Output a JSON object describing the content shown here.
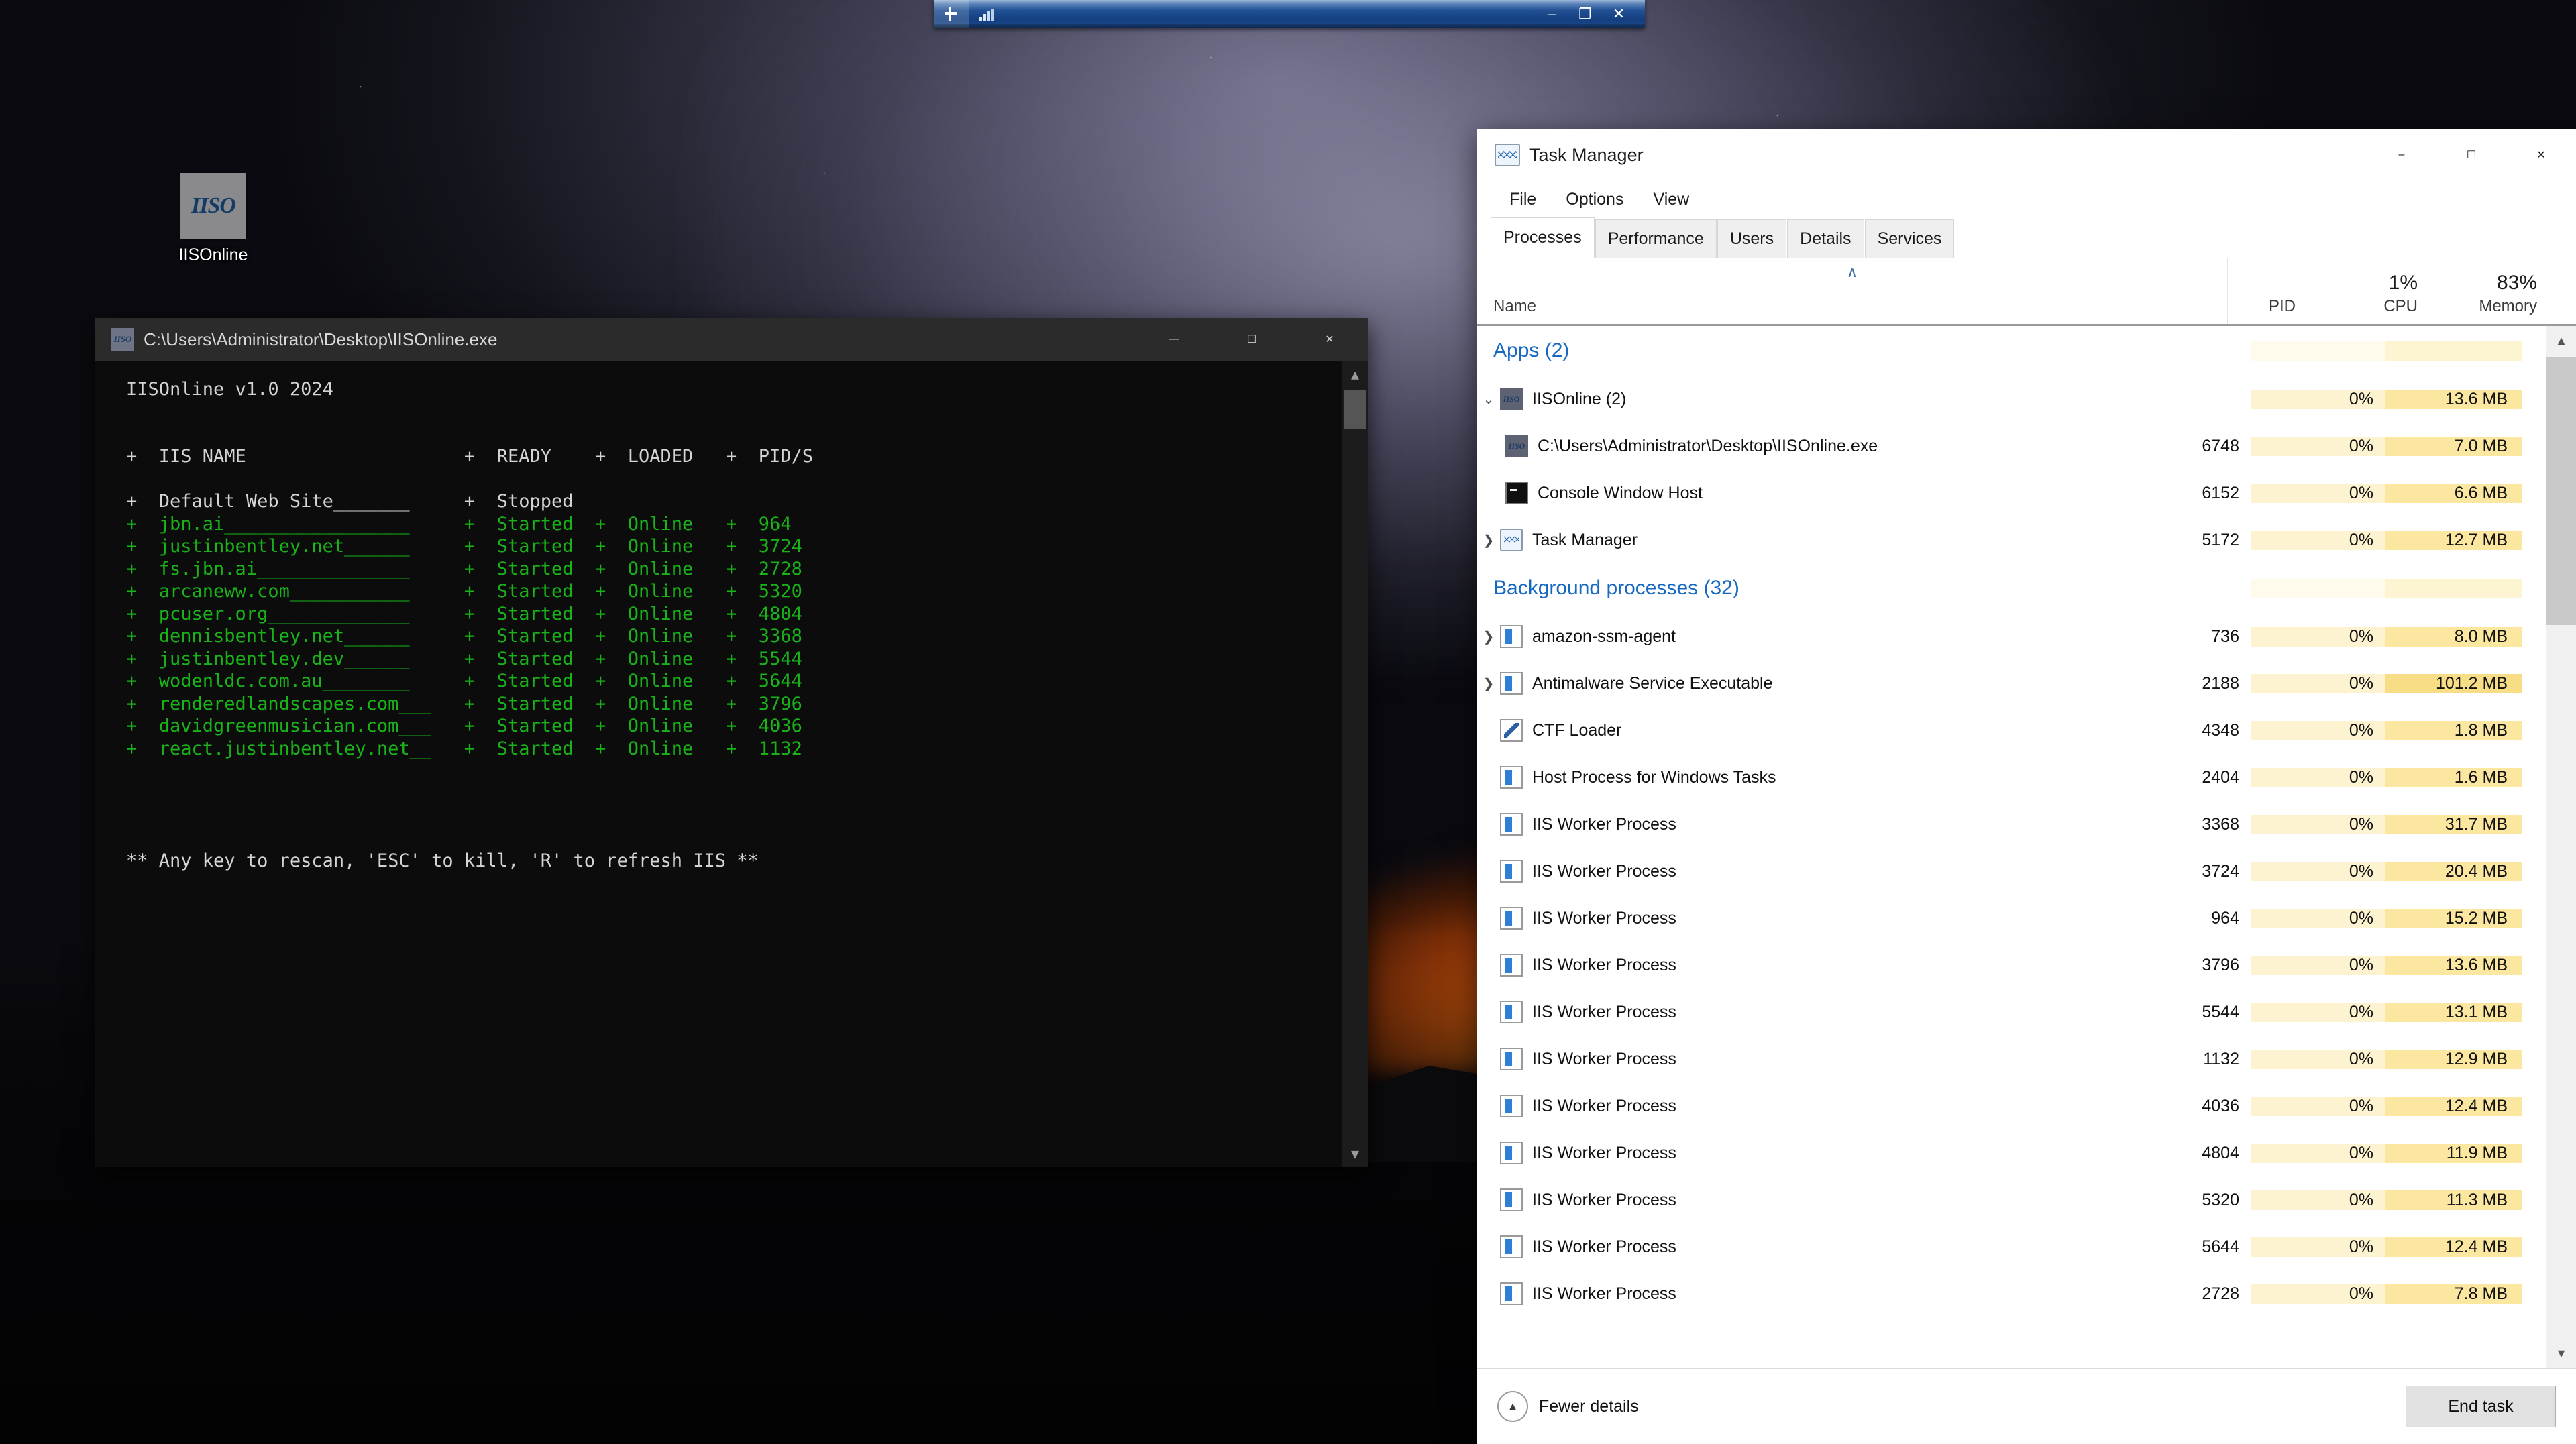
{
  "desktop": {
    "icon": {
      "label": "IISOnline",
      "glyph": "IISO",
      "name": "iisonline-desktop-icon"
    }
  },
  "top_bar": {
    "icons": [
      "pin-icon",
      "signal-bars-icon"
    ],
    "controls": {
      "minimize": "–",
      "restore": "❐",
      "close": "✕"
    }
  },
  "console": {
    "title": "C:\\Users\\Administrator\\Desktop\\IISOnline.exe",
    "icon_glyph": "IISO",
    "controls": {
      "minimize": "—",
      "maximize": "☐",
      "close": "✕"
    },
    "header_line": "IISOnline v1.0 2024",
    "columns": [
      "IIS NAME",
      "READY",
      "LOADED",
      "PID/S"
    ],
    "column_header_text": "+  IIS NAME                       +  READY    +  LOADED   +  PID/S",
    "rows": [
      {
        "name": "Default Web Site",
        "pad": "_______",
        "ready": "Stopped",
        "loaded": "",
        "pid": "",
        "color": "white"
      },
      {
        "name": "jbn.ai",
        "pad": "_________________",
        "ready": "Started",
        "loaded": "Online",
        "pid": "964",
        "color": "green"
      },
      {
        "name": "justinbentley.net",
        "pad": "______",
        "ready": "Started",
        "loaded": "Online",
        "pid": "3724",
        "color": "green"
      },
      {
        "name": "fs.jbn.ai",
        "pad": "______________",
        "ready": "Started",
        "loaded": "Online",
        "pid": "2728",
        "color": "green"
      },
      {
        "name": "arcaneww.com",
        "pad": "___________",
        "ready": "Started",
        "loaded": "Online",
        "pid": "5320",
        "color": "green"
      },
      {
        "name": "pcuser.org",
        "pad": "_____________",
        "ready": "Started",
        "loaded": "Online",
        "pid": "4804",
        "color": "green"
      },
      {
        "name": "dennisbentley.net",
        "pad": "______",
        "ready": "Started",
        "loaded": "Online",
        "pid": "3368",
        "color": "green"
      },
      {
        "name": "justinbentley.dev",
        "pad": "______",
        "ready": "Started",
        "loaded": "Online",
        "pid": "5544",
        "color": "green"
      },
      {
        "name": "wodenldc.com.au",
        "pad": "________",
        "ready": "Started",
        "loaded": "Online",
        "pid": "5644",
        "color": "green"
      },
      {
        "name": "renderedlandscapes.com",
        "pad": "___",
        "ready": "Started",
        "loaded": "Online",
        "pid": "3796",
        "color": "green"
      },
      {
        "name": "davidgreenmusician.com",
        "pad": "___",
        "ready": "Started",
        "loaded": "Online",
        "pid": "4036",
        "color": "green"
      },
      {
        "name": "react.justinbentley.net",
        "pad": "__",
        "ready": "Started",
        "loaded": "Online",
        "pid": "1132",
        "color": "green"
      }
    ],
    "footer": "** Any key to rescan, 'ESC' to kill, 'R' to refresh IIS **"
  },
  "task_manager": {
    "title": "Task Manager",
    "window_controls": {
      "minimize": "–",
      "maximize": "☐",
      "close": "✕"
    },
    "menus": [
      "File",
      "Options",
      "View"
    ],
    "tabs": [
      {
        "label": "Processes",
        "active": true
      },
      {
        "label": "Performance",
        "active": false
      },
      {
        "label": "Users",
        "active": false
      },
      {
        "label": "Details",
        "active": false
      },
      {
        "label": "Services",
        "active": false
      }
    ],
    "columns": {
      "name": "Name",
      "pid": "PID",
      "cpu": "CPU",
      "memory": "Memory",
      "cpu_total": "1%",
      "memory_total": "83%",
      "sort_indicator": "∧"
    },
    "groups": [
      {
        "label": "Apps (2)"
      },
      {
        "label": "Background processes (32)"
      }
    ],
    "rows": [
      {
        "type": "group",
        "label": "Apps (2)"
      },
      {
        "type": "process",
        "name": "IISOnline (2)",
        "pid": "",
        "cpu": "0%",
        "memory": "13.6 MB",
        "icon": "iiso",
        "expanded": true,
        "level": 0,
        "mem_tint": "tint-mem"
      },
      {
        "type": "process",
        "name": "C:\\Users\\Administrator\\Desktop\\IISOnline.exe",
        "pid": "6748",
        "cpu": "0%",
        "memory": "7.0 MB",
        "icon": "iiso",
        "expanded": null,
        "level": 1,
        "mem_tint": "tint-mem"
      },
      {
        "type": "process",
        "name": "Console Window Host",
        "pid": "6152",
        "cpu": "0%",
        "memory": "6.6 MB",
        "icon": "console",
        "expanded": null,
        "level": 1,
        "mem_tint": "tint-mem"
      },
      {
        "type": "process",
        "name": "Task Manager",
        "pid": "5172",
        "cpu": "0%",
        "memory": "12.7 MB",
        "icon": "tm",
        "expanded": false,
        "level": 0,
        "mem_tint": "tint-mem"
      },
      {
        "type": "group",
        "label": "Background processes (32)"
      },
      {
        "type": "process",
        "name": "amazon-ssm-agent",
        "pid": "736",
        "cpu": "0%",
        "memory": "8.0 MB",
        "icon": "generic",
        "expanded": false,
        "level": 0,
        "mem_tint": "tint-mem"
      },
      {
        "type": "process",
        "name": "Antimalware Service Executable",
        "pid": "2188",
        "cpu": "0%",
        "memory": "101.2 MB",
        "icon": "generic",
        "expanded": false,
        "level": 0,
        "mem_tint": "tint-mem-hot"
      },
      {
        "type": "process",
        "name": "CTF Loader",
        "pid": "4348",
        "cpu": "0%",
        "memory": "1.8 MB",
        "icon": "ctf",
        "expanded": null,
        "level": 0,
        "mem_tint": "tint-mem"
      },
      {
        "type": "process",
        "name": "Host Process for Windows Tasks",
        "pid": "2404",
        "cpu": "0%",
        "memory": "1.6 MB",
        "icon": "generic",
        "expanded": null,
        "level": 0,
        "mem_tint": "tint-mem"
      },
      {
        "type": "process",
        "name": "IIS Worker Process",
        "pid": "3368",
        "cpu": "0%",
        "memory": "31.7 MB",
        "icon": "generic",
        "expanded": null,
        "level": 0,
        "mem_tint": "tint-mem"
      },
      {
        "type": "process",
        "name": "IIS Worker Process",
        "pid": "3724",
        "cpu": "0%",
        "memory": "20.4 MB",
        "icon": "generic",
        "expanded": null,
        "level": 0,
        "mem_tint": "tint-mem"
      },
      {
        "type": "process",
        "name": "IIS Worker Process",
        "pid": "964",
        "cpu": "0%",
        "memory": "15.2 MB",
        "icon": "generic",
        "expanded": null,
        "level": 0,
        "mem_tint": "tint-mem"
      },
      {
        "type": "process",
        "name": "IIS Worker Process",
        "pid": "3796",
        "cpu": "0%",
        "memory": "13.6 MB",
        "icon": "generic",
        "expanded": null,
        "level": 0,
        "mem_tint": "tint-mem"
      },
      {
        "type": "process",
        "name": "IIS Worker Process",
        "pid": "5544",
        "cpu": "0%",
        "memory": "13.1 MB",
        "icon": "generic",
        "expanded": null,
        "level": 0,
        "mem_tint": "tint-mem"
      },
      {
        "type": "process",
        "name": "IIS Worker Process",
        "pid": "1132",
        "cpu": "0%",
        "memory": "12.9 MB",
        "icon": "generic",
        "expanded": null,
        "level": 0,
        "mem_tint": "tint-mem"
      },
      {
        "type": "process",
        "name": "IIS Worker Process",
        "pid": "4036",
        "cpu": "0%",
        "memory": "12.4 MB",
        "icon": "generic",
        "expanded": null,
        "level": 0,
        "mem_tint": "tint-mem"
      },
      {
        "type": "process",
        "name": "IIS Worker Process",
        "pid": "4804",
        "cpu": "0%",
        "memory": "11.9 MB",
        "icon": "generic",
        "expanded": null,
        "level": 0,
        "mem_tint": "tint-mem"
      },
      {
        "type": "process",
        "name": "IIS Worker Process",
        "pid": "5320",
        "cpu": "0%",
        "memory": "11.3 MB",
        "icon": "generic",
        "expanded": null,
        "level": 0,
        "mem_tint": "tint-mem"
      },
      {
        "type": "process",
        "name": "IIS Worker Process",
        "pid": "5644",
        "cpu": "0%",
        "memory": "12.4 MB",
        "icon": "generic",
        "expanded": null,
        "level": 0,
        "mem_tint": "tint-mem"
      },
      {
        "type": "process",
        "name": "IIS Worker Process",
        "pid": "2728",
        "cpu": "0%",
        "memory": "7.8 MB",
        "icon": "generic",
        "expanded": null,
        "level": 0,
        "mem_tint": "tint-mem"
      }
    ],
    "footer": {
      "fewer_details": "Fewer details",
      "end_task": "End task"
    }
  },
  "colors": {
    "accent_blue": "#1668c1",
    "console_green": "#19b319",
    "console_white": "#d4d4d4",
    "cpu_tint": "#fdf3d0",
    "memory_tint": "#fbe79f",
    "memory_hot_tint": "#f7dd86"
  }
}
